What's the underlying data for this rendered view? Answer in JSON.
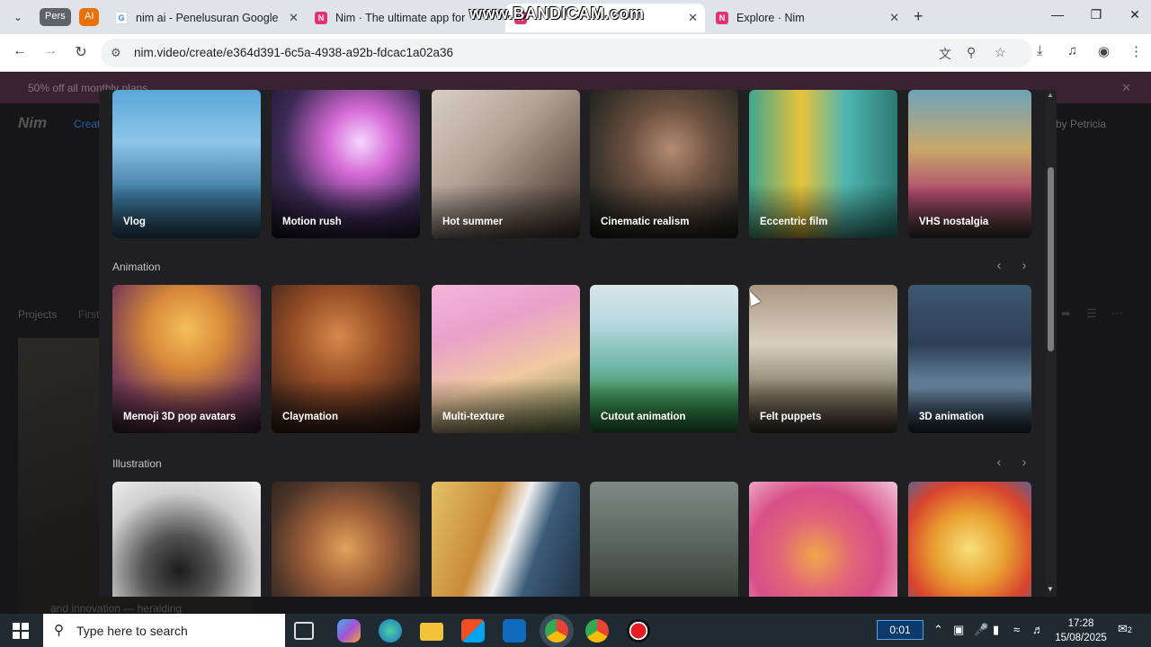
{
  "browser": {
    "group_chips": [
      "Pers",
      "AI"
    ],
    "tabs": [
      {
        "title": "nim ai - Penelusuran Google",
        "favicon": "G"
      },
      {
        "title": "Nim · The ultimate app for AI",
        "favicon": "N"
      },
      {
        "title": "",
        "favicon": "N"
      },
      {
        "title": "Explore · Nim",
        "favicon": "N"
      }
    ],
    "url": "nim.video/create/e364d391-6c5a-4938-a92b-fdcac1a02a36",
    "watermark": "www.BANDICAM.com"
  },
  "background_page": {
    "promo": "50% off all monthly plans",
    "logo": "Nim",
    "create_link": "Create",
    "user": "by Petricia",
    "projects_label": "Projects",
    "first_label": "First",
    "caption": "and innovation — heralding"
  },
  "modal": {
    "top_row": {
      "cards": [
        {
          "label": "Vlog"
        },
        {
          "label": "Motion rush"
        },
        {
          "label": "Hot summer"
        },
        {
          "label": "Cinematic realism"
        },
        {
          "label": "Eccentric film"
        },
        {
          "label": "VHS nostalgia"
        }
      ]
    },
    "sections": [
      {
        "title": "Animation",
        "cards": [
          {
            "label": "Memoji 3D pop avatars"
          },
          {
            "label": "Claymation"
          },
          {
            "label": "Multi-texture"
          },
          {
            "label": "Cutout animation"
          },
          {
            "label": "Felt puppets"
          },
          {
            "label": "3D animation"
          }
        ]
      },
      {
        "title": "Illustration",
        "cards": [
          {
            "label": ""
          },
          {
            "label": ""
          },
          {
            "label": ""
          },
          {
            "label": ""
          },
          {
            "label": ""
          },
          {
            "label": ""
          }
        ]
      }
    ]
  },
  "taskbar": {
    "search_placeholder": "Type here to search",
    "recording_time": "0:01",
    "time": "17:28",
    "date": "15/08/2025",
    "notification_count": "2"
  },
  "colors": {
    "accent_nim": "#e0317a",
    "modal_bg": "#202022",
    "page_bg": "#161618"
  }
}
